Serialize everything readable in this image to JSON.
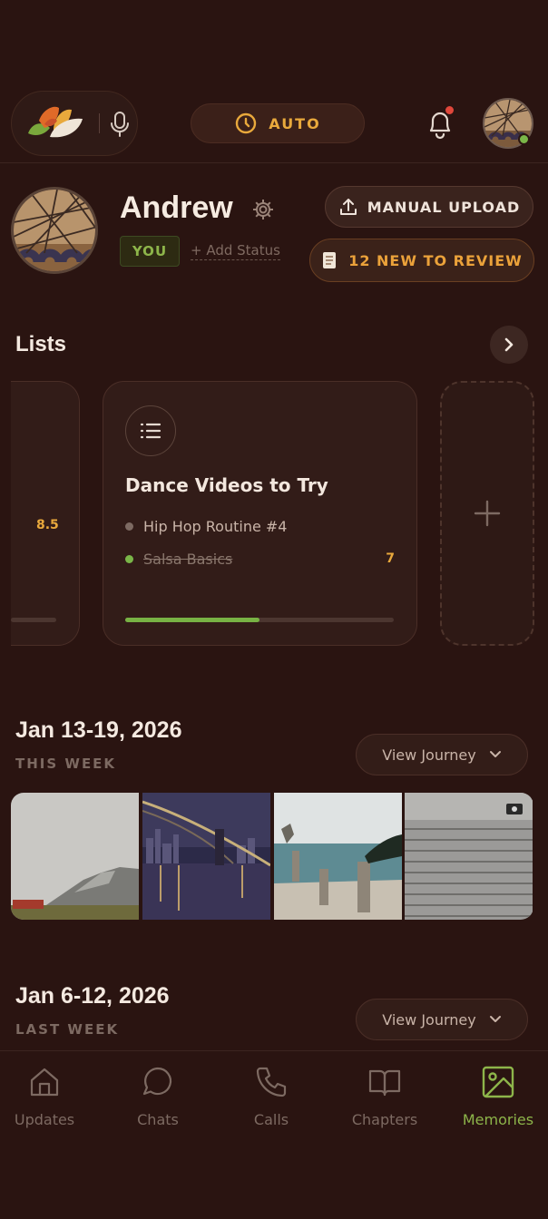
{
  "header": {
    "mode_label": "AUTO",
    "notification_badge": true
  },
  "profile": {
    "name": "Andrew",
    "you_badge": "YOU",
    "add_status": "+ Add Status",
    "manual_upload_label": "MANUAL UPLOAD",
    "review_label": "12 NEW TO REVIEW"
  },
  "lists": {
    "title": "Lists",
    "partial_card_value": "8.5",
    "card": {
      "title": "Dance Videos to Try",
      "items": [
        {
          "label": "Hip Hop Routine #4",
          "done": false
        },
        {
          "label": "Salsa Basics",
          "done": true
        }
      ],
      "count": "7",
      "progress": 0.5
    }
  },
  "weeks": [
    {
      "title": "Jan 13-19, 2026",
      "subtitle": "THIS WEEK",
      "button": "View Journey"
    },
    {
      "title": "Jan 6-12, 2026",
      "subtitle": "LAST WEEK",
      "button": "View Journey"
    }
  ],
  "photos": [
    "mountain-photo",
    "bridge-night-photo",
    "pier-photo",
    "steps-photo"
  ],
  "nav": [
    {
      "label": "Updates",
      "icon": "home-icon",
      "active": false
    },
    {
      "label": "Chats",
      "icon": "chat-icon",
      "active": false
    },
    {
      "label": "Calls",
      "icon": "phone-icon",
      "active": false
    },
    {
      "label": "Chapters",
      "icon": "book-icon",
      "active": false
    },
    {
      "label": "Memories",
      "icon": "image-icon",
      "active": true
    }
  ],
  "colors": {
    "background": "#2a1411",
    "accent_orange": "#e9a93c",
    "accent_green": "#8db54a"
  }
}
